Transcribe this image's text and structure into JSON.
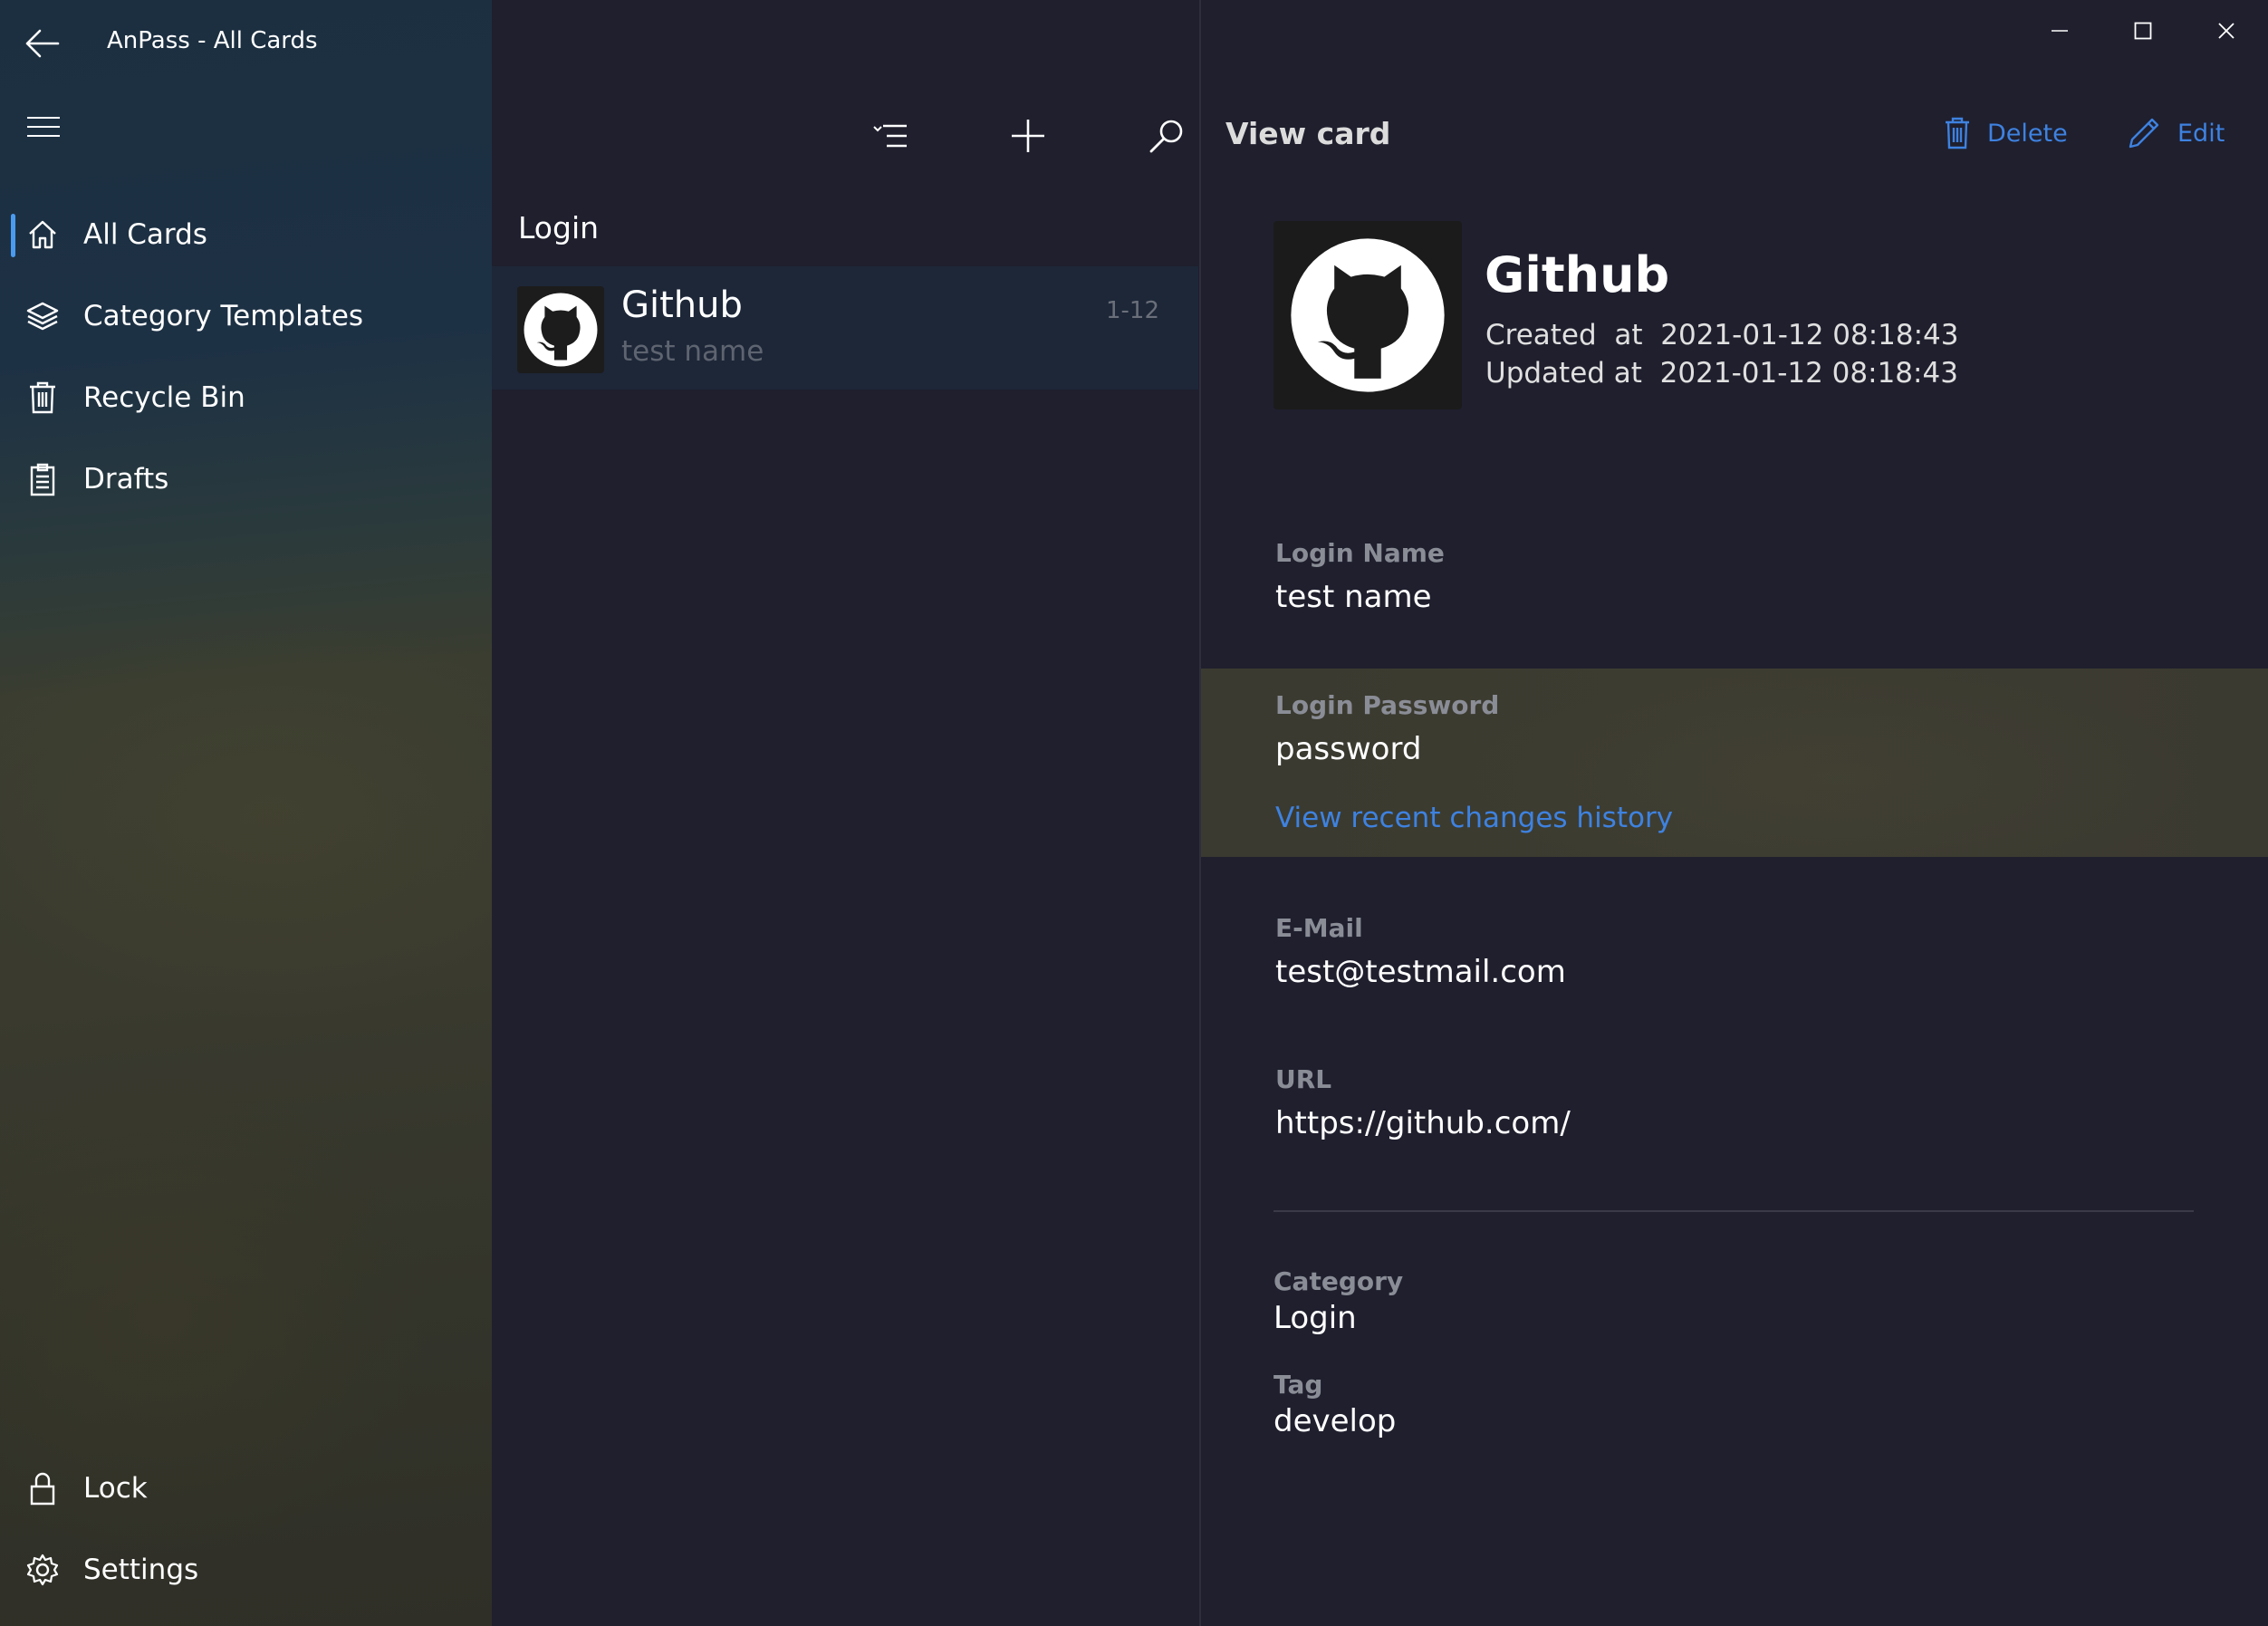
{
  "window": {
    "title": "AnPass - All Cards"
  },
  "sidebar": {
    "items": [
      {
        "label": "All Cards",
        "icon": "home-icon",
        "selected": true
      },
      {
        "label": "Category Templates",
        "icon": "layers-icon",
        "selected": false
      },
      {
        "label": "Recycle Bin",
        "icon": "trash-icon",
        "selected": false
      },
      {
        "label": "Drafts",
        "icon": "clipboard-icon",
        "selected": false
      }
    ],
    "bottom_items": [
      {
        "label": "Lock",
        "icon": "lock-icon"
      },
      {
        "label": "Settings",
        "icon": "gear-icon"
      }
    ],
    "accent": "#4a9bf0"
  },
  "list": {
    "group_header": "Login",
    "cards": [
      {
        "title": "Github",
        "subtitle": "test name",
        "date": "1-12",
        "icon": "github-icon"
      }
    ]
  },
  "detail": {
    "title": "View card",
    "delete_label": "Delete",
    "edit_label": "Edit",
    "name": "Github",
    "created_label": "Created  at",
    "created_value": "2021-01-12 08:18:43",
    "updated_label": "Updated at",
    "updated_value": "2021-01-12 08:18:43",
    "fields": {
      "login_name": {
        "label": "Login Name",
        "value": "test name"
      },
      "login_password": {
        "label": "Login Password",
        "value": "password",
        "link": "View recent changes history"
      },
      "email": {
        "label": "E-Mail",
        "value": "test@testmail.com"
      },
      "url": {
        "label": "URL",
        "value": "https://github.com/"
      }
    },
    "category": {
      "label": "Category",
      "value": "Login"
    },
    "tag": {
      "label": "Tag",
      "value": "develop"
    },
    "link_color": "#3e82e0"
  }
}
